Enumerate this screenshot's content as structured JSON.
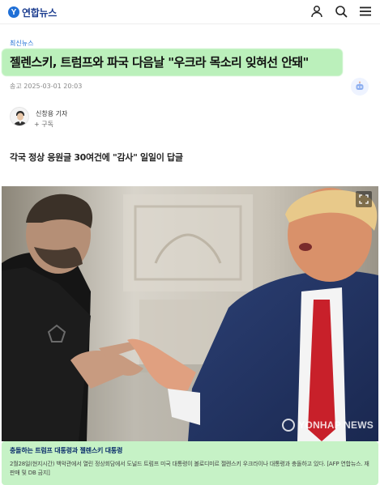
{
  "header": {
    "logo_text": "연합뉴스",
    "logo_mark": "Y",
    "icons": [
      "user-icon",
      "search-icon",
      "menu-icon"
    ]
  },
  "article": {
    "category": "최신뉴스",
    "title": "젤렌스키, 트럼프와 파국 다음날 \"우크라 목소리 잊혀선 안돼\"",
    "date": "송고 2025-03-01 20:03",
    "reporter": {
      "name": "신창용 기자",
      "subscribe": "+ 구독"
    },
    "subtitle": "각국 정상 응원글 30여건에 \"감사\" 일일이 답글",
    "photo": {
      "watermark": "YONHAP NEWS"
    },
    "caption": {
      "title": "충돌하는 트럼프 대통령과 젤렌스키 대통령",
      "body": "2월28일(현지시간) 백악관에서 열린 정상회담에서 도널드 트럼프 미국 대통령이 볼로디미르 젤렌스키 우크라이나 대통령과 충돌하고 있다. [AFP 연합뉴스. 재판매 및 DB 금지]"
    }
  },
  "colors": {
    "brand_blue": "#1f6fd6",
    "highlight_green": "#97e897"
  }
}
